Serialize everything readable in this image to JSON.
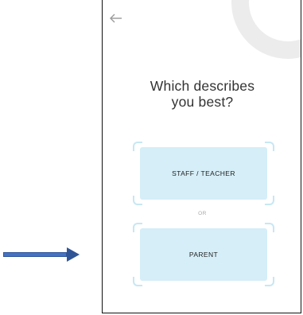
{
  "screen": {
    "question": "Which describes\nyou best?",
    "separator": "OR",
    "options": [
      {
        "label": "STAFF / TEACHER"
      },
      {
        "label": "PARENT"
      }
    ]
  },
  "icons": {
    "back": "arrow-left-icon",
    "decoration": "ring-decoration",
    "pointer": "arrow-right-icon"
  },
  "colors": {
    "pointer_arrow": "#2f5597",
    "button_fill": "#d5eef8",
    "bracket": "#c7e7f3",
    "ring": "#ececec",
    "text": "#333333",
    "separator_text": "#a6a6a6"
  }
}
